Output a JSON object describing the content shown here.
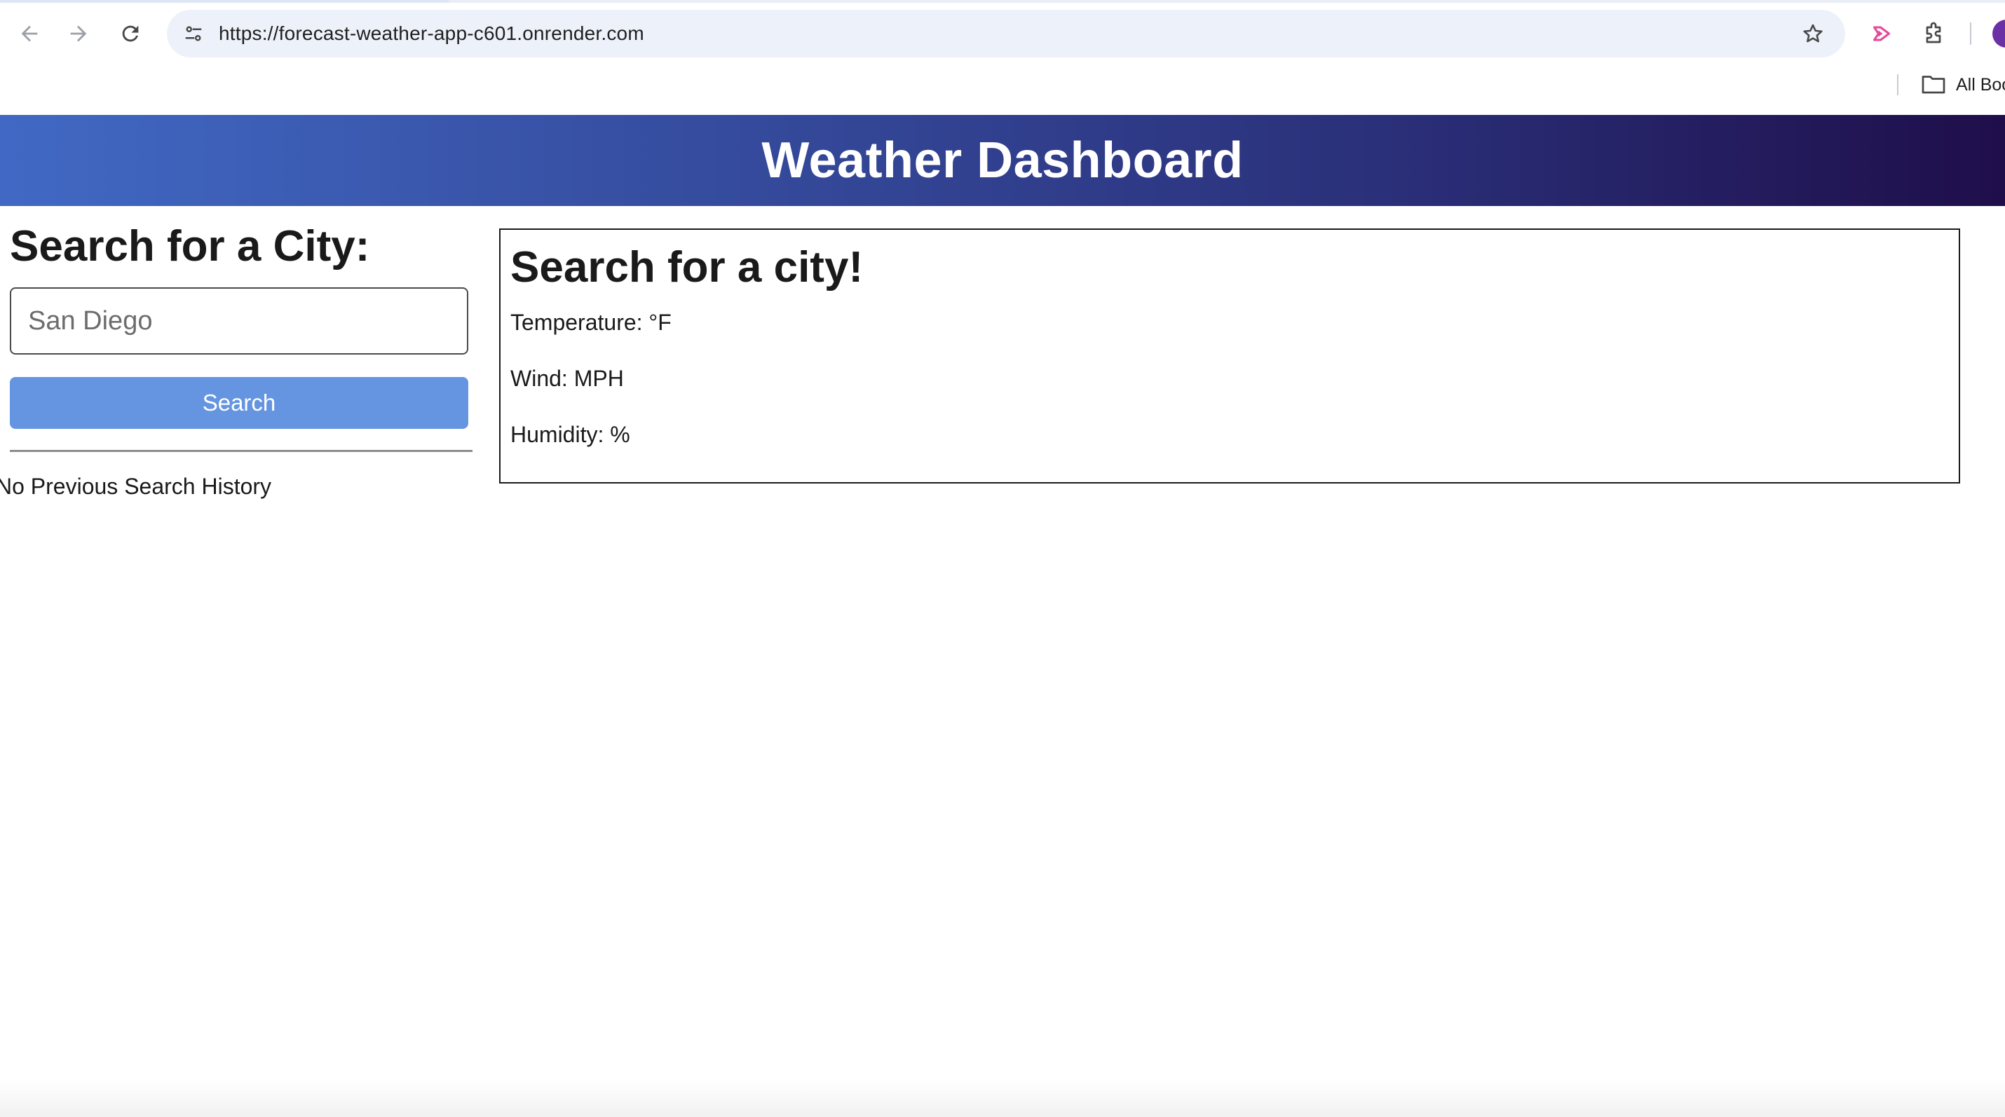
{
  "browser": {
    "url": "https://forecast-weather-app-c601.onrender.com",
    "bookmarks_label": "All Bookmarks",
    "icons": {
      "back": "arrow-left-icon",
      "forward": "arrow-right-icon",
      "reload": "reload-icon",
      "site_info": "tune-icon",
      "bookmark": "star-icon",
      "extension_media": "media-play-icon",
      "extensions": "puzzle-icon",
      "folder": "folder-icon"
    },
    "colors": {
      "omnibox_bg": "#edf1f9",
      "avatar": "#6b2fa6",
      "media_icon": "#e6479a"
    }
  },
  "header": {
    "title": "Weather Dashboard",
    "gradient": [
      "#4169c4",
      "#1f0e4a"
    ]
  },
  "search": {
    "heading": "Search for a City:",
    "input_placeholder": "San Diego",
    "input_value": "",
    "button_label": "Search",
    "button_color": "#6595e0",
    "history_label": "No Previous Search History"
  },
  "weather": {
    "heading": "Search for a city!",
    "temperature_label": "Temperature: °F",
    "wind_label": "Wind: MPH",
    "humidity_label": "Humidity: %"
  }
}
